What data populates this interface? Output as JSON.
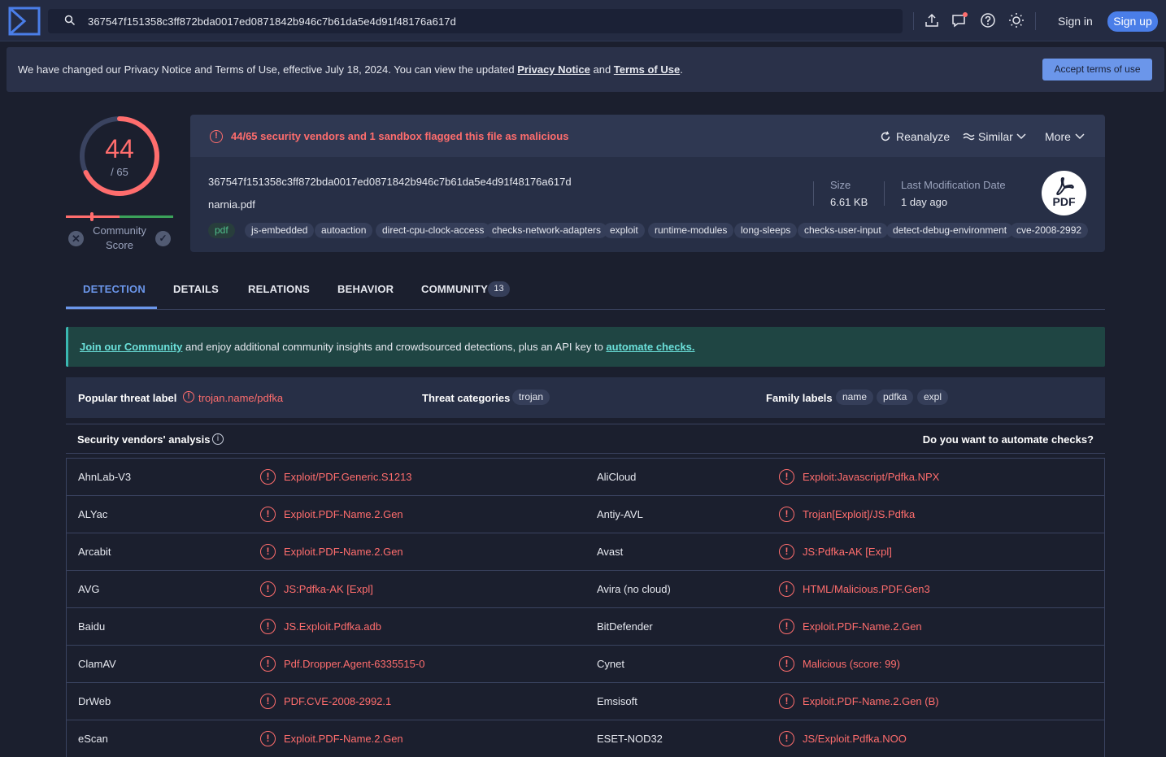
{
  "search": {
    "value": "367547f151358c3ff872bda0017ed0871842b946c7b61da5e4d91f48176a617d"
  },
  "header": {
    "signin": "Sign in",
    "signup": "Sign up"
  },
  "notice": {
    "text_before": "We have changed our Privacy Notice and Terms of Use, effective July 18, 2024. You can view the updated ",
    "privacy_link": "Privacy Notice",
    "and": " and ",
    "terms_link": "Terms of Use",
    "dot": ".",
    "accept": "Accept terms of use"
  },
  "score": {
    "detections": "44",
    "total": "/ 65",
    "community_label_1": "Community",
    "community_label_2": "Score"
  },
  "summary": {
    "alert": "44/65 security vendors and 1 sandbox flagged this file as malicious",
    "reanalyze": "Reanalyze",
    "similar": "Similar",
    "more": "More",
    "hash": "367547f151358c3ff872bda0017ed0871842b946c7b61da5e4d91f48176a617d",
    "filename": "narnia.pdf",
    "size_label": "Size",
    "size_value": "6.61 KB",
    "lastmod_label": "Last Modification Date",
    "lastmod_value": "1 day ago",
    "filetype_badge": "PDF",
    "tags": [
      "pdf",
      "js-embedded",
      "autoaction",
      "direct-cpu-clock-access",
      "checks-network-adapters",
      "exploit",
      "runtime-modules",
      "long-sleeps",
      "checks-user-input",
      "detect-debug-environment",
      "cve-2008-2992"
    ]
  },
  "tabs": [
    {
      "label": "DETECTION",
      "active": true
    },
    {
      "label": "DETAILS"
    },
    {
      "label": "RELATIONS"
    },
    {
      "label": "BEHAVIOR"
    },
    {
      "label": "COMMUNITY",
      "count": "13"
    }
  ],
  "join": {
    "link1": "Join our Community",
    "middle": " and enjoy additional community insights and crowdsourced detections, plus an API key to ",
    "link2": "automate checks."
  },
  "threat": {
    "popular_label": "Popular threat label",
    "popular_value": "trojan.name/pdfka",
    "categories_label": "Threat categories",
    "categories": [
      "trojan"
    ],
    "family_label": "Family labels",
    "families": [
      "name",
      "pdfka",
      "expl"
    ]
  },
  "vendors": {
    "title": "Security vendors' analysis",
    "automate": "Do you want to automate checks?",
    "rows": [
      {
        "left_name": "AhnLab-V3",
        "left_result": "Exploit/PDF.Generic.S1213",
        "right_name": "AliCloud",
        "right_result": "Exploit:Javascript/Pdfka.NPX"
      },
      {
        "left_name": "ALYac",
        "left_result": "Exploit.PDF-Name.2.Gen",
        "right_name": "Antiy-AVL",
        "right_result": "Trojan[Exploit]/JS.Pdfka"
      },
      {
        "left_name": "Arcabit",
        "left_result": "Exploit.PDF-Name.2.Gen",
        "right_name": "Avast",
        "right_result": "JS:Pdfka-AK [Expl]"
      },
      {
        "left_name": "AVG",
        "left_result": "JS:Pdfka-AK [Expl]",
        "right_name": "Avira (no cloud)",
        "right_result": "HTML/Malicious.PDF.Gen3"
      },
      {
        "left_name": "Baidu",
        "left_result": "JS.Exploit.Pdfka.adb",
        "right_name": "BitDefender",
        "right_result": "Exploit.PDF-Name.2.Gen"
      },
      {
        "left_name": "ClamAV",
        "left_result": "Pdf.Dropper.Agent-6335515-0",
        "right_name": "Cynet",
        "right_result": "Malicious (score: 99)"
      },
      {
        "left_name": "DrWeb",
        "left_result": "PDF.CVE-2008-2992.1",
        "right_name": "Emsisoft",
        "right_result": "Exploit.PDF-Name.2.Gen (B)"
      },
      {
        "left_name": "eScan",
        "left_result": "Exploit.PDF-Name.2.Gen",
        "right_name": "ESET-NOD32",
        "right_result": "JS/Exploit.Pdfka.NOO"
      }
    ]
  },
  "colors": {
    "malicious": "#ff6d6d",
    "accent": "#6b96ea",
    "background": "#1b1f2e"
  }
}
